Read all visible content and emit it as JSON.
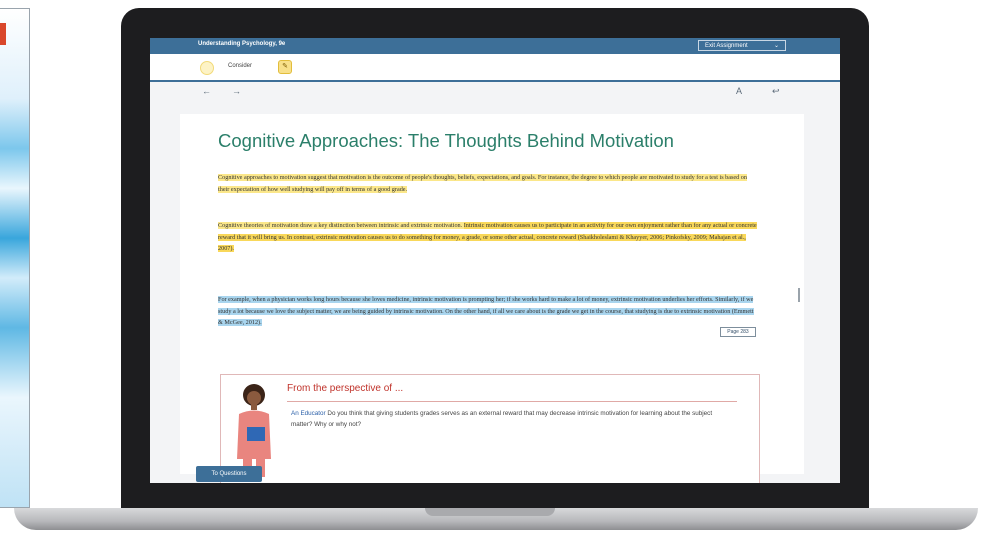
{
  "app": {
    "title": "Understanding Psychology, 9e",
    "exit_label": "Exit Assignment"
  },
  "toolbar": {
    "label": "Consider"
  },
  "reader": {
    "heading": "Cognitive Approaches: The Thoughts Behind Motivation",
    "p1": "Cognitive approaches to motivation suggest that motivation is the outcome of people's thoughts, beliefs, expectations, and goals. For instance, the degree to which people are motivated to study for a test is based on their expectation of how well studying will pay off in terms of a good grade.",
    "p2a": "Cognitive theories of motivation draw a key distinction between intrinsic and extrinsic motivation. ",
    "p2b": "Intrinsic motivation causes us to participate in an activity for our own enjoyment rather than for any actual or concrete reward that it will bring us. In contrast, extrinsic motivation causes us to do something for money, a grade, or some other actual, concrete reward (Shaikholeslami & Khayyer, 2006; Pinkofsky, 2009; Mahajan et al., 2007).",
    "p3": "For example, when a physician works long hours because she loves medicine, intrinsic motivation is prompting her; if she works hard to make a lot of money, extrinsic motivation underlies her efforts. Similarly, if we study a lot because we love the subject matter, we are being guided by intrinsic motivation. On the other hand, if all we care about is the grade we get in the course, that studying is due to extrinsic motivation (Emmett & McGee, 2012).",
    "page_label": "Page 283"
  },
  "perspective": {
    "title": "From the perspective of ...",
    "role": "An Educator",
    "question": " Do you think that giving students grades serves as an external reward that may decrease intrinsic motivation for learning about the subject matter? Why or why not?"
  },
  "footer": {
    "button": "To Questions"
  },
  "colors": {
    "header": "#3d6f98",
    "heading": "#2b7f6a",
    "highlight_yellow": "#fbe78a",
    "highlight_blue": "#a9d5ee",
    "perspective_title": "#c0332b"
  }
}
